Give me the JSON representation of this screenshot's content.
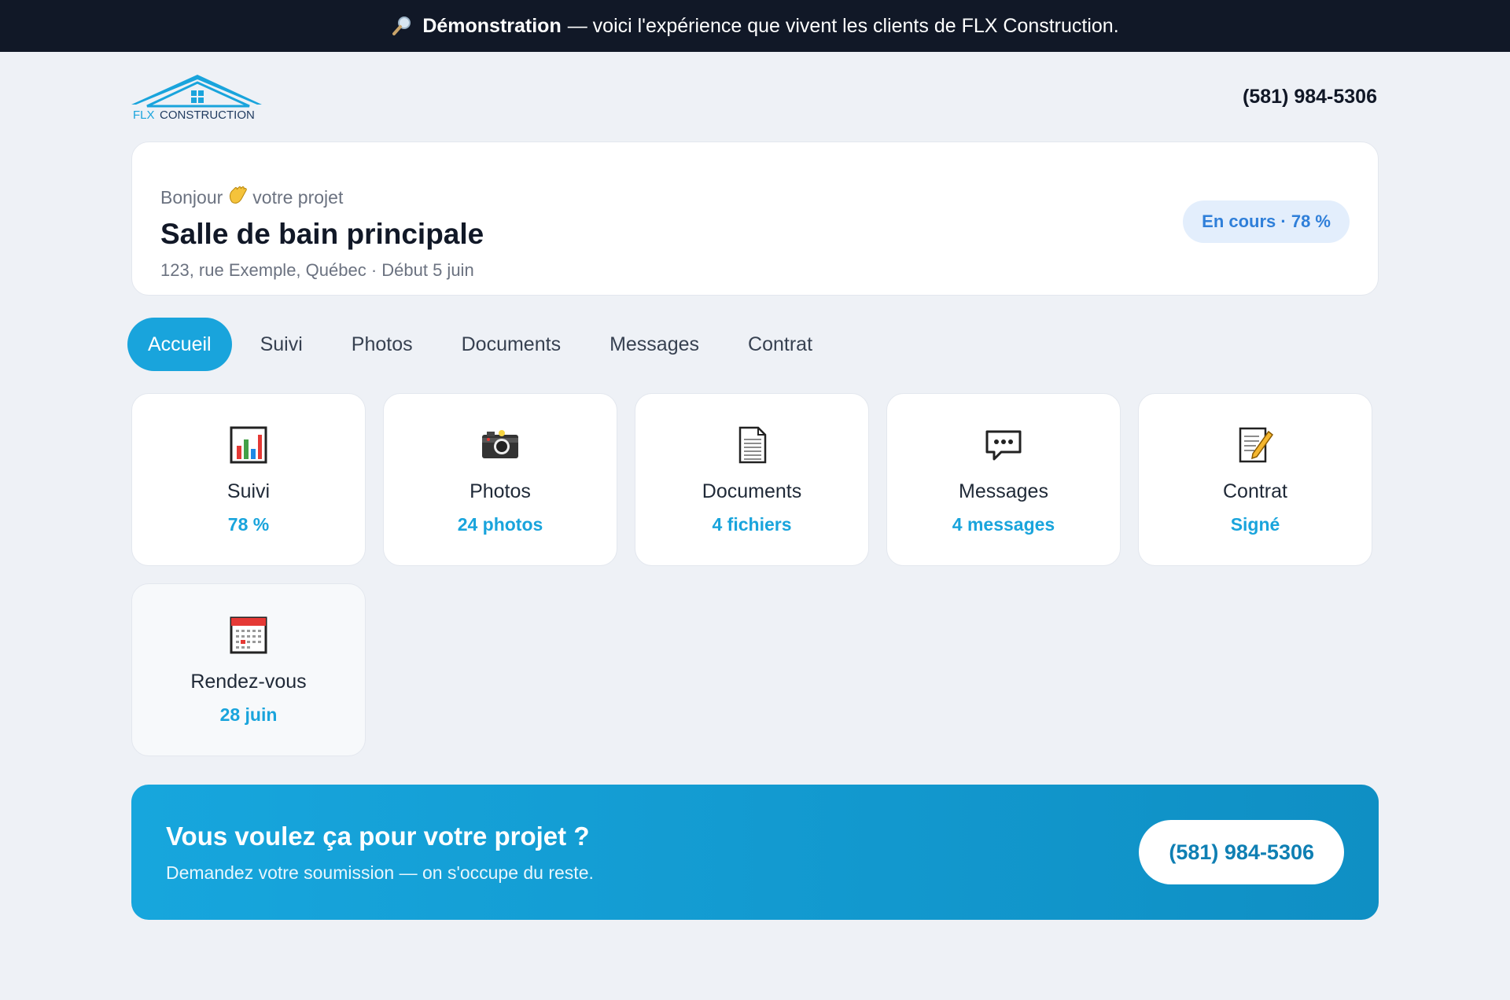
{
  "demo_banner": {
    "bold": "Démonstration",
    "rest": "— voici l'expérience que vivent les clients de FLX Construction."
  },
  "header": {
    "logo_text_flx": "FLX",
    "logo_text_construction": "CONSTRUCTION",
    "phone": "(581) 984-5306"
  },
  "project": {
    "greeting": "Bonjour",
    "greeting_suffix": "votre projet",
    "title": "Salle de bain principale",
    "address": "123, rue Exemple, Québec · Début 5 juin",
    "status": "En cours · 78 %"
  },
  "tabs": [
    {
      "label": "Accueil",
      "active": true
    },
    {
      "label": "Suivi"
    },
    {
      "label": "Photos"
    },
    {
      "label": "Documents"
    },
    {
      "label": "Messages"
    },
    {
      "label": "Contrat"
    }
  ],
  "tiles": [
    {
      "icon": "bar-chart-icon",
      "label": "Suivi",
      "value": "78 %"
    },
    {
      "icon": "camera-icon",
      "label": "Photos",
      "value": "24 photos"
    },
    {
      "icon": "document-icon",
      "label": "Documents",
      "value": "4 fichiers"
    },
    {
      "icon": "speech-bubble-icon",
      "label": "Messages",
      "value": "4 messages"
    },
    {
      "icon": "memo-pencil-icon",
      "label": "Contrat",
      "value": "Signé"
    },
    {
      "icon": "calendar-icon",
      "label": "Rendez-vous",
      "value": "28 juin"
    }
  ],
  "cta": {
    "title": "Vous voulez ça pour votre projet ?",
    "subtitle": "Demandez votre soumission — on s'occupe du reste.",
    "button": "(581) 984-5306"
  },
  "colors": {
    "accent": "#19a4dc",
    "status_bg": "#e3eefc",
    "status_text": "#2f7fd9",
    "banner_bg": "#111827"
  }
}
